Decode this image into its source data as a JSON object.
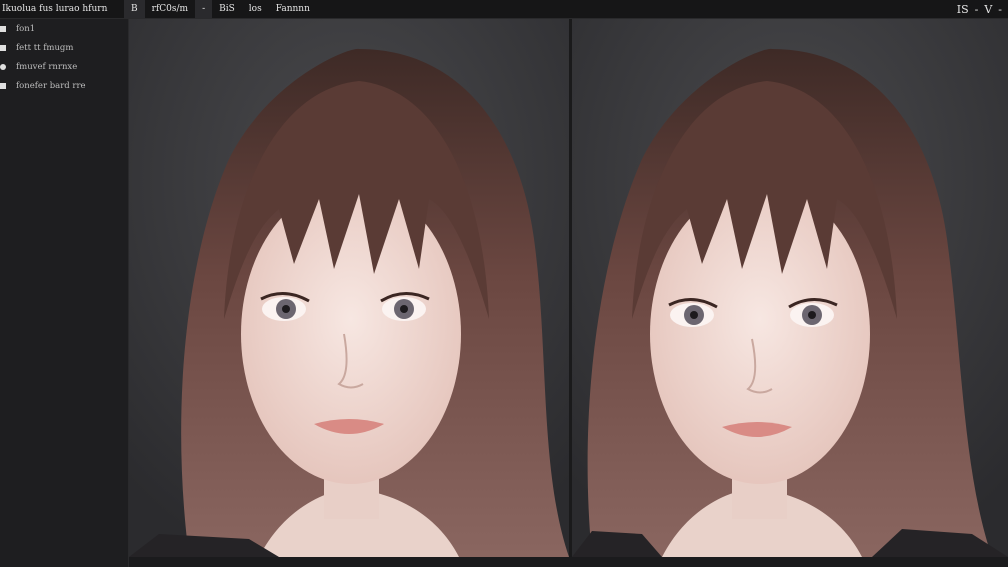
{
  "app": {
    "title": "Ikuolua fus lurao hfurn"
  },
  "toolbar": {
    "tabs": [
      {
        "label": "B"
      },
      {
        "label": "rfC0s/m"
      },
      {
        "label": "-"
      },
      {
        "label": "BiS"
      },
      {
        "label": "los"
      },
      {
        "label": "Fannnn"
      }
    ],
    "right_controls": [
      "IS",
      "-",
      "V",
      "-"
    ]
  },
  "sidebar": {
    "items": [
      {
        "label": "fon1",
        "icon": "square-bullet-icon"
      },
      {
        "label": "fett tt fmugm",
        "icon": "square-bullet-icon"
      },
      {
        "label": "fmuvef rnrnxe",
        "icon": "round-bullet-icon"
      },
      {
        "label": "fonefer bard rre",
        "icon": "square-bullet-icon"
      }
    ]
  },
  "colors": {
    "background": "#1b1b1d",
    "panel_bg": "#2a2a2c",
    "hair": "#5a3a33",
    "skin": "#f1dcd5"
  }
}
